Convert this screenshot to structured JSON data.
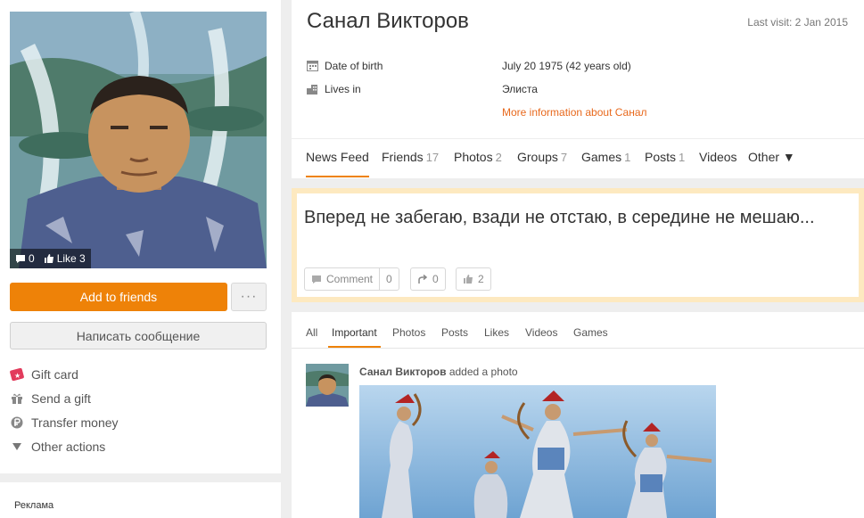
{
  "avatar": {
    "comments": "0",
    "likes": "Like 3"
  },
  "left": {
    "add_friend": "Add to friends",
    "more": "···",
    "message": "Написать сообщение",
    "actions": [
      {
        "label": "Gift card",
        "icon": "gift-card-icon"
      },
      {
        "label": "Send a gift",
        "icon": "gift-icon"
      },
      {
        "label": "Transfer money",
        "icon": "ruble-icon"
      },
      {
        "label": "Other actions",
        "icon": "triangle-down-icon"
      }
    ],
    "ad_label": "Реклама"
  },
  "profile": {
    "name": "Санал Викторов",
    "last_visit": "Last visit: 2 Jan 2015",
    "dob_label": "Date of birth",
    "dob_value": "July 20 1975 (42 years old)",
    "lives_label": "Lives in",
    "lives_value": "Элиста",
    "more_info": "More information about Санал"
  },
  "tabs": [
    {
      "label": "News Feed",
      "count": ""
    },
    {
      "label": "Friends",
      "count": "17"
    },
    {
      "label": "Photos",
      "count": "2"
    },
    {
      "label": "Groups",
      "count": "7"
    },
    {
      "label": "Games",
      "count": "1"
    },
    {
      "label": "Posts",
      "count": "1"
    },
    {
      "label": "Videos",
      "count": ""
    },
    {
      "label": "Other ▼",
      "count": ""
    }
  ],
  "status": {
    "text": "Вперед не забегаю, взади не отстаю, в середине не мешаю...",
    "comment_label": "Comment",
    "comment_count": "0",
    "share_count": "0",
    "like_count": "2"
  },
  "feed": {
    "tabs": [
      "All",
      "Important",
      "Photos",
      "Posts",
      "Likes",
      "Videos",
      "Games"
    ],
    "author": "Санал Викторов",
    "action": " added a photo"
  },
  "colors": {
    "accent": "#ee8208",
    "link": "#e8691d",
    "status_border": "#fde9c0"
  }
}
